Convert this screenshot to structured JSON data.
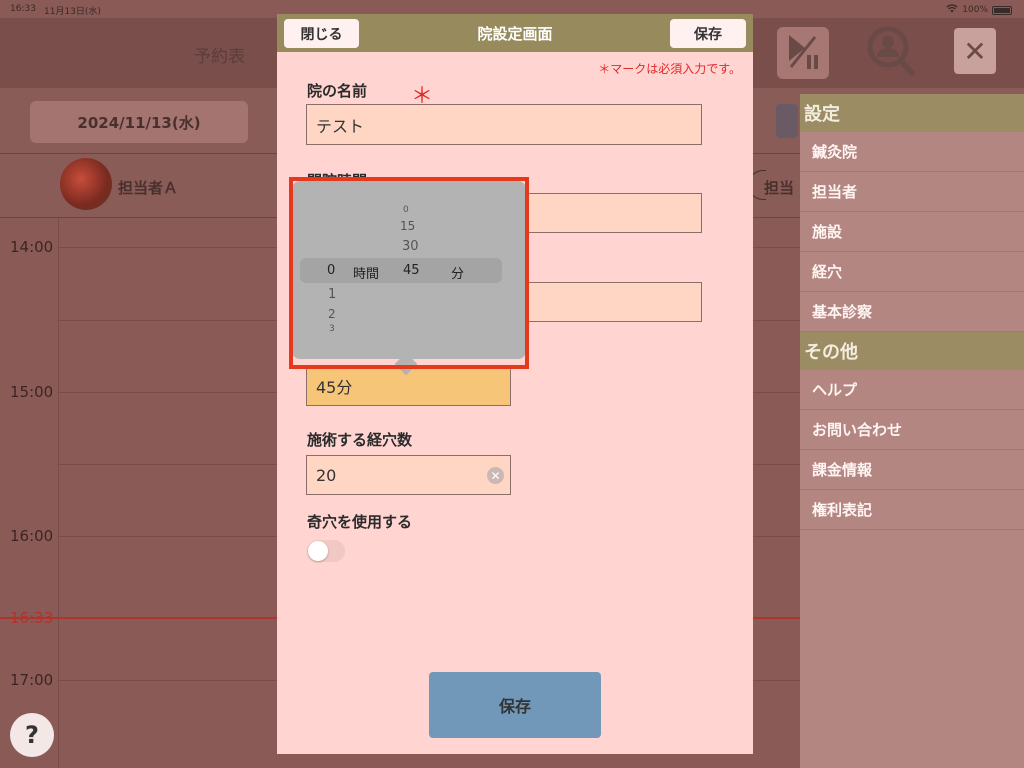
{
  "status_bar": {
    "time": "16:33",
    "date": "11月13日(水)",
    "battery": "100%"
  },
  "background": {
    "title": "予約表",
    "date_button": "2024/11/13(水)",
    "staff": [
      "担当者Ａ",
      "担当"
    ],
    "times": [
      "14:00",
      "15:00",
      "16:00",
      "16:33",
      "17:00"
    ],
    "help": "?"
  },
  "sidebar": {
    "sections": [
      {
        "title": "設定",
        "items": [
          "鍼灸院",
          "担当者",
          "施設",
          "経穴",
          "基本診察"
        ]
      },
      {
        "title": "その他",
        "items": [
          "ヘルプ",
          "お問い合わせ",
          "課金情報",
          "権利表記"
        ]
      }
    ]
  },
  "modal": {
    "title": "院設定画面",
    "close_label": "閉じる",
    "save_label": "保存",
    "required_note": "＊マークは必須入力です。",
    "required_mark": "＊",
    "clinic_name_label": "院の名前",
    "clinic_name_value": "テスト",
    "open_hours_label": "開院時間",
    "duration_value": "45分",
    "points_label": "施術する経穴数",
    "points_value": "20",
    "odd_points_label": "奇穴を使用する",
    "odd_points_enabled": false,
    "save_bottom_label": "保存"
  },
  "picker": {
    "minutes_above": [
      "0",
      "15",
      "30"
    ],
    "hours_below": [
      "1",
      "2",
      "3"
    ],
    "selected_hour": "0",
    "hour_unit": "時間",
    "selected_minute": "45",
    "minute_unit": "分"
  }
}
